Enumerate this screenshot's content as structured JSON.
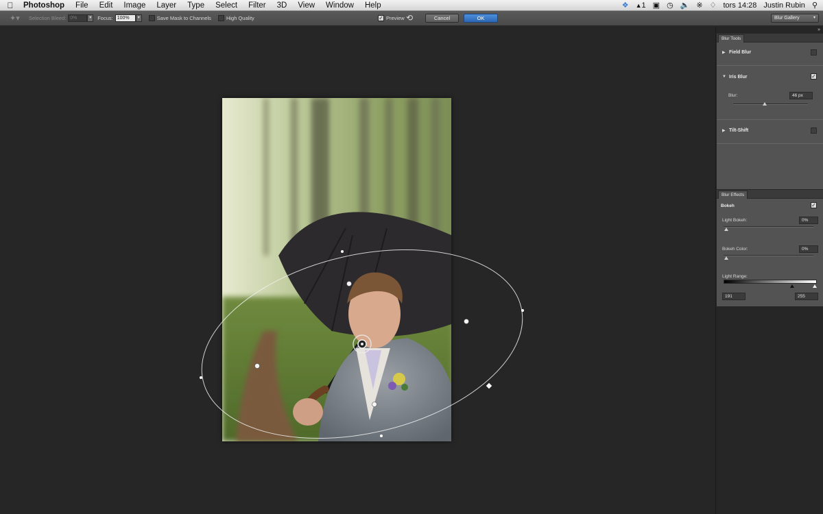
{
  "menubar": {
    "apple_icon": "apple-logo-icon",
    "app_name": "Photoshop",
    "menus": [
      "File",
      "Edit",
      "Image",
      "Layer",
      "Type",
      "Select",
      "Filter",
      "3D",
      "View",
      "Window",
      "Help"
    ],
    "status": {
      "adobe_count": "1",
      "clock": "tors 14:28",
      "user": "Justin Rubin"
    }
  },
  "options_bar": {
    "selection_bleed_label": "Selection Bleed:",
    "selection_bleed_value": "0%",
    "focus_label": "Focus:",
    "focus_value": "100%",
    "save_mask_label": "Save Mask to Channels",
    "high_quality_label": "High Quality",
    "preview_label": "Preview",
    "preview_checked": true,
    "cancel_label": "Cancel",
    "ok_label": "OK",
    "workspace": "Blur Gallery"
  },
  "blur_tools": {
    "tab": "Blur Tools",
    "field_blur": {
      "label": "Field Blur",
      "checked": false
    },
    "iris_blur": {
      "label": "Iris Blur",
      "checked": true,
      "blur_label": "Blur:",
      "blur_value": "46 px"
    },
    "tilt_shift": {
      "label": "Tilt-Shift",
      "checked": false
    }
  },
  "blur_effects": {
    "tab": "Blur Effects",
    "bokeh_label": "Bokeh",
    "bokeh_checked": true,
    "light_bokeh_label": "Light Bokeh:",
    "light_bokeh_value": "0%",
    "bokeh_color_label": "Bokeh Color:",
    "bokeh_color_value": "0%",
    "light_range_label": "Light Range:",
    "light_range_low": "191",
    "light_range_high": "255"
  },
  "colors": {
    "ok_button": "#2d67b4",
    "panel_bg": "#535353",
    "canvas_bg": "#262626"
  }
}
